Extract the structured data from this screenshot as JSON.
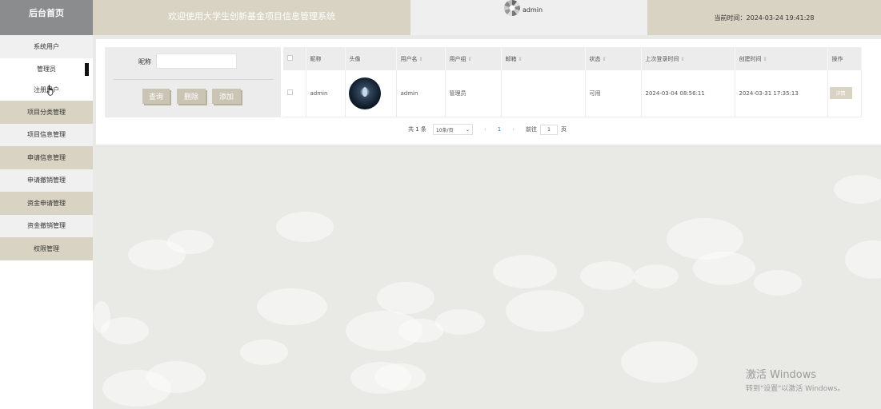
{
  "header": {
    "brand": "后台首页",
    "welcome": "欢迎使用大学生创新基金项目信息管理系统",
    "user_name": "admin",
    "time_label": "当前时间：",
    "time_value": "2024-03-24 19:41:28"
  },
  "sidebar": {
    "head": "系统用户",
    "sub_items": [
      "管理员",
      "注册用户"
    ],
    "items": [
      "项目分类管理",
      "项目信息管理",
      "申请信息管理",
      "申请撤销管理",
      "资金申请管理",
      "资金撤销管理",
      "权限管理"
    ]
  },
  "search": {
    "label": "昵称",
    "value": "",
    "buttons": {
      "query": "查询",
      "delete": "删除",
      "add": "添加"
    }
  },
  "table": {
    "headers": [
      "昵称",
      "头像",
      "用户名",
      "用户组",
      "邮箱",
      "状态",
      "上次登录时间",
      "创建时间",
      "操作"
    ],
    "rows": [
      {
        "nickname": "admin",
        "username": "admin",
        "group": "管理员",
        "email": "",
        "status": "可用",
        "last_login": "2024-03-04 08:56:11",
        "created": "2024-03-31 17:35:13",
        "action": "详情"
      }
    ]
  },
  "pager": {
    "total": "共 1 条",
    "page_size": "10条/页",
    "current": "1",
    "goto_label": "前往",
    "goto_value": "1",
    "page_suffix": "页"
  },
  "watermark": {
    "line1": "激活 Windows",
    "line2": "转到\"设置\"以激活 Windows。"
  },
  "colors": {
    "accent": "#d8d3c3",
    "brand_bg": "#8a8c8e",
    "page_bg": "#e9e9e6",
    "link": "#1e88c7"
  }
}
